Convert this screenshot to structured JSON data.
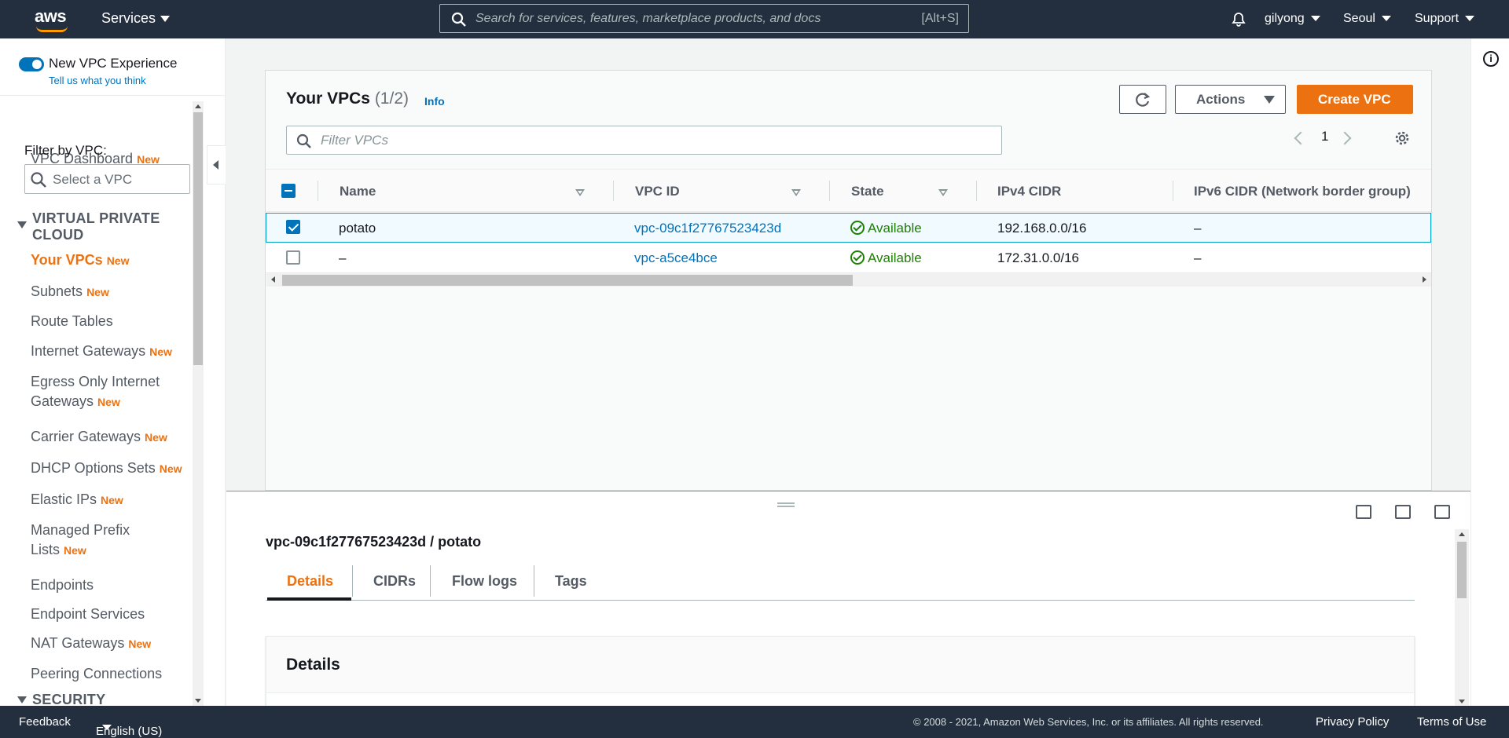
{
  "topnav": {
    "logo_text": "aws",
    "services_label": "Services",
    "search_placeholder": "Search for services, features, marketplace products, and docs",
    "search_shortcut": "[Alt+S]",
    "user": "gilyong",
    "region": "Seoul",
    "support": "Support"
  },
  "sidebar": {
    "toggle_label": "New VPC Experience",
    "toggle_on": true,
    "tell_us": "Tell us what you think",
    "dashboard": "VPC Dashboard",
    "new_badge": "New",
    "filter_label": "Filter by VPC:",
    "filter_placeholder": "Select a VPC",
    "section_vpc": "VIRTUAL PRIVATE CLOUD",
    "section_security": "SECURITY",
    "items": [
      {
        "label": "Your VPCs",
        "new": true,
        "active": true
      },
      {
        "label": "Subnets",
        "new": true
      },
      {
        "label": "Route Tables",
        "new": false
      },
      {
        "label": "Internet Gateways",
        "new": true
      },
      {
        "label": "Egress Only Internet Gateways",
        "new": true
      },
      {
        "label": "Carrier Gateways",
        "new": true
      },
      {
        "label": "DHCP Options Sets",
        "new": true
      },
      {
        "label": "Elastic IPs",
        "new": true
      },
      {
        "label": "Managed Prefix Lists",
        "new": true
      },
      {
        "label": "Endpoints",
        "new": false
      },
      {
        "label": "Endpoint Services",
        "new": false
      },
      {
        "label": "NAT Gateways",
        "new": true
      },
      {
        "label": "Peering Connections",
        "new": false
      }
    ]
  },
  "main": {
    "title": "Your VPCs",
    "count": "(1/2)",
    "info": "Info",
    "actions_label": "Actions",
    "create_label": "Create VPC",
    "filter_placeholder": "Filter VPCs",
    "page_number": "1",
    "columns": [
      "Name",
      "VPC ID",
      "State",
      "IPv4 CIDR",
      "IPv6 CIDR (Network border group)"
    ],
    "rows": [
      {
        "selected": true,
        "name": "potato",
        "vpc_id": "vpc-09c1f27767523423d",
        "state": "Available",
        "ipv4": "192.168.0.0/16",
        "ipv6": "–"
      },
      {
        "selected": false,
        "name": "–",
        "vpc_id": "vpc-a5ce4bce",
        "state": "Available",
        "ipv4": "172.31.0.0/16",
        "ipv6": "–"
      }
    ]
  },
  "details": {
    "title": "vpc-09c1f27767523423d / potato",
    "tabs": [
      "Details",
      "CIDRs",
      "Flow logs",
      "Tags"
    ],
    "active_tab": "Details",
    "section_title": "Details"
  },
  "footer": {
    "feedback": "Feedback",
    "language": "English (US)",
    "copyright": "© 2008 - 2021, Amazon Web Services, Inc. or its affiliates. All rights reserved.",
    "privacy": "Privacy Policy",
    "terms": "Terms of Use"
  },
  "colors": {
    "nav_bg": "#232f3e",
    "accent_orange": "#ec7211",
    "link_blue": "#0073bb",
    "success_green": "#1d8102"
  }
}
